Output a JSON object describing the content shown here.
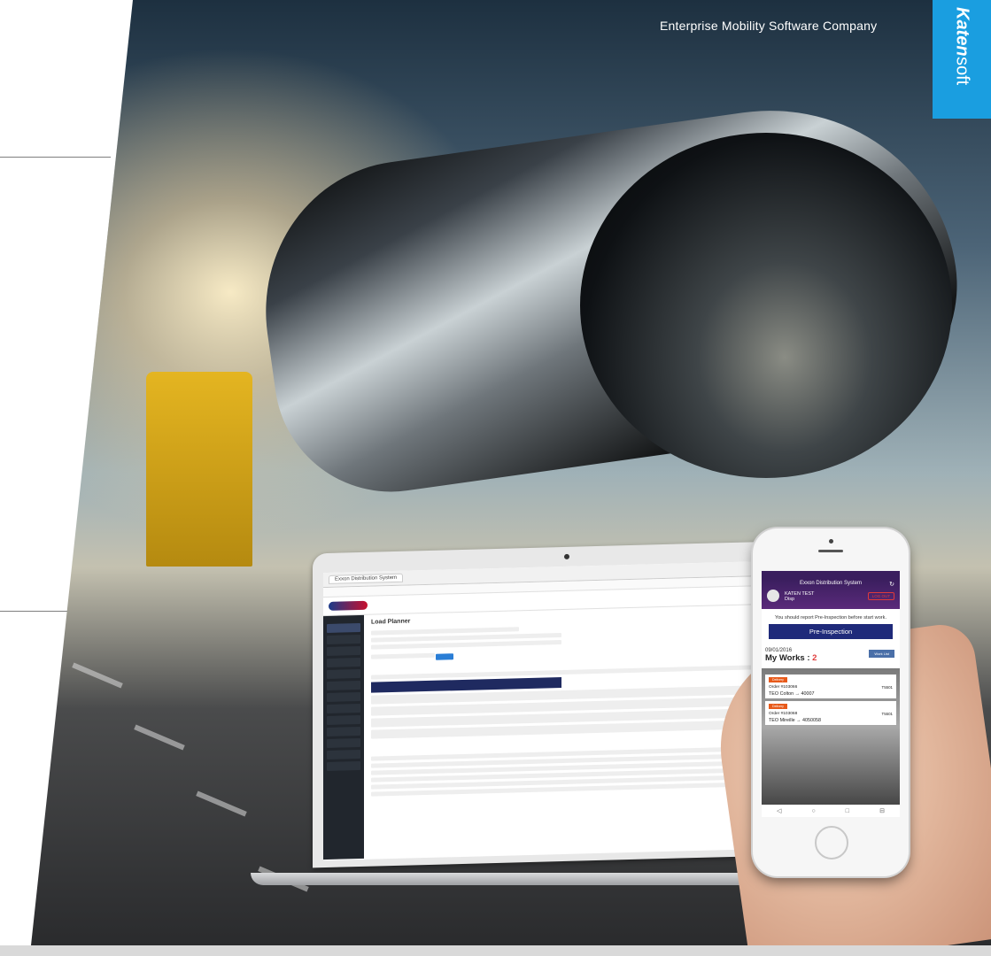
{
  "header": {
    "tagline": "Enterprise Mobility Software Company",
    "brand_bold": "Katen",
    "brand_light": "soft"
  },
  "laptop": {
    "tab_title": "Exxon Distribution System",
    "page_title": "Load Planner"
  },
  "phone": {
    "app_title": "Exxon Distribution System",
    "user_name": "KATEN TEST",
    "user_role": "Disp",
    "logout_label": "LOG OUT",
    "notice": "You should report Pre-Inspection before start work.",
    "pre_inspection_label": "Pre-Inspection",
    "date": "09/01/2016",
    "works_label": "My Works :",
    "works_count": "2",
    "work_list_label": "Work List",
    "cards": [
      {
        "badge": "Delivery",
        "order": "Order #103066",
        "desc": "TEO Colton → 40007",
        "id": "T5501"
      },
      {
        "badge": "Delivery",
        "order": "Order #103068",
        "desc": "TEO Mireille → 4050058",
        "id": "T5501"
      }
    ],
    "nav": [
      "◁",
      "○",
      "□",
      "⊟"
    ]
  },
  "colors": {
    "brand": "#1a9ee0",
    "pre_inspection": "#1f2a7a",
    "phone_header": "#3a1e5e",
    "alert": "#e03b3b"
  }
}
